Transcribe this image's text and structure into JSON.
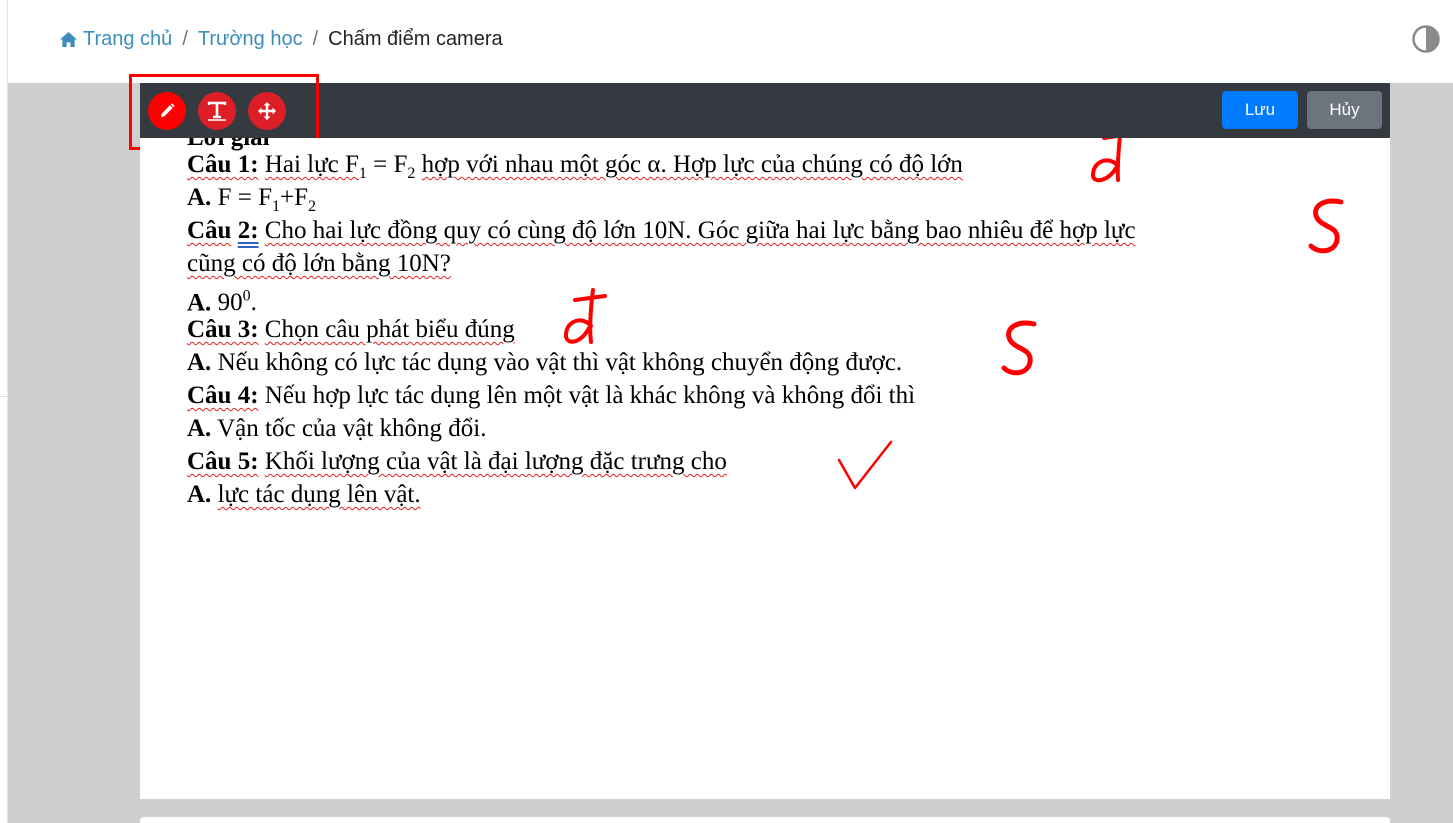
{
  "breadcrumb": {
    "home": "Trang chủ",
    "school": "Trường học",
    "separator": "/",
    "current": "Chấm điểm camera"
  },
  "icons": {
    "home": "home-icon",
    "theme": "contrast-half-circle-icon",
    "pencil": "pencil-icon",
    "text": "text-tool-icon",
    "move": "move-arrows-icon"
  },
  "toolbar": {
    "save_label": "Lưu",
    "cancel_label": "Hủy"
  },
  "colors": {
    "link": "#3c8dbc",
    "toolbar_bg": "#343a40",
    "save": "#007bff",
    "cancel": "#6c757d",
    "tool_button": "#dc1f26",
    "highlight": "#ff0000",
    "ink": "#ff0000"
  },
  "document": {
    "cut_line": "Lời giải",
    "q1_label": "Câu 1:",
    "q1_text": "Hai lực F",
    "q1_sub1": "1",
    "q1_eq": " = F",
    "q1_sub2": "2",
    "q1_rest": "hợp với nhau một góc α. Hợp lực của chúng có độ lớn",
    "a1_label": "A.",
    "a1_text": "F = F",
    "a1_sub1": "1",
    "a1_plus": "+F",
    "a1_sub2": "2",
    "q2_label": "Câu",
    "q2_num": "2:",
    "q2_text": "Cho hai lực đồng quy có cùng độ lớn 10N. Góc giữa hai lực bằng bao nhiêu để hợp lực",
    "q2_cont": "cũng có độ lớn bằng 10N?",
    "a2_label": "A.",
    "a2_text": "90",
    "a2_sup": "0",
    "a2_end": ".",
    "q3_label": "Câu 3:",
    "q3_text": "Chọn câu phát biểu đúng",
    "a3_label": "A.",
    "a3_text": "Nếu không có lực tác dụng vào vật thì vật không chuyển động được.",
    "q4_label": "Câu 4:",
    "q4_text": "Nếu hợp lực tác dụng lên một vật là khác không và không đổi thì",
    "a4_label": "A.",
    "a4_text": "Vận tốc của vật không đổi.",
    "q5_label": "Câu 5:",
    "q5_text": "Khối lượng của vật là đại lượng đặc trưng cho",
    "a5_label": "A.",
    "a5_text": "lực tác dụng lên vật."
  },
  "marks": {
    "q1": "đ",
    "q2": "S",
    "q3": "đ",
    "a3": "S",
    "q5": "check"
  }
}
